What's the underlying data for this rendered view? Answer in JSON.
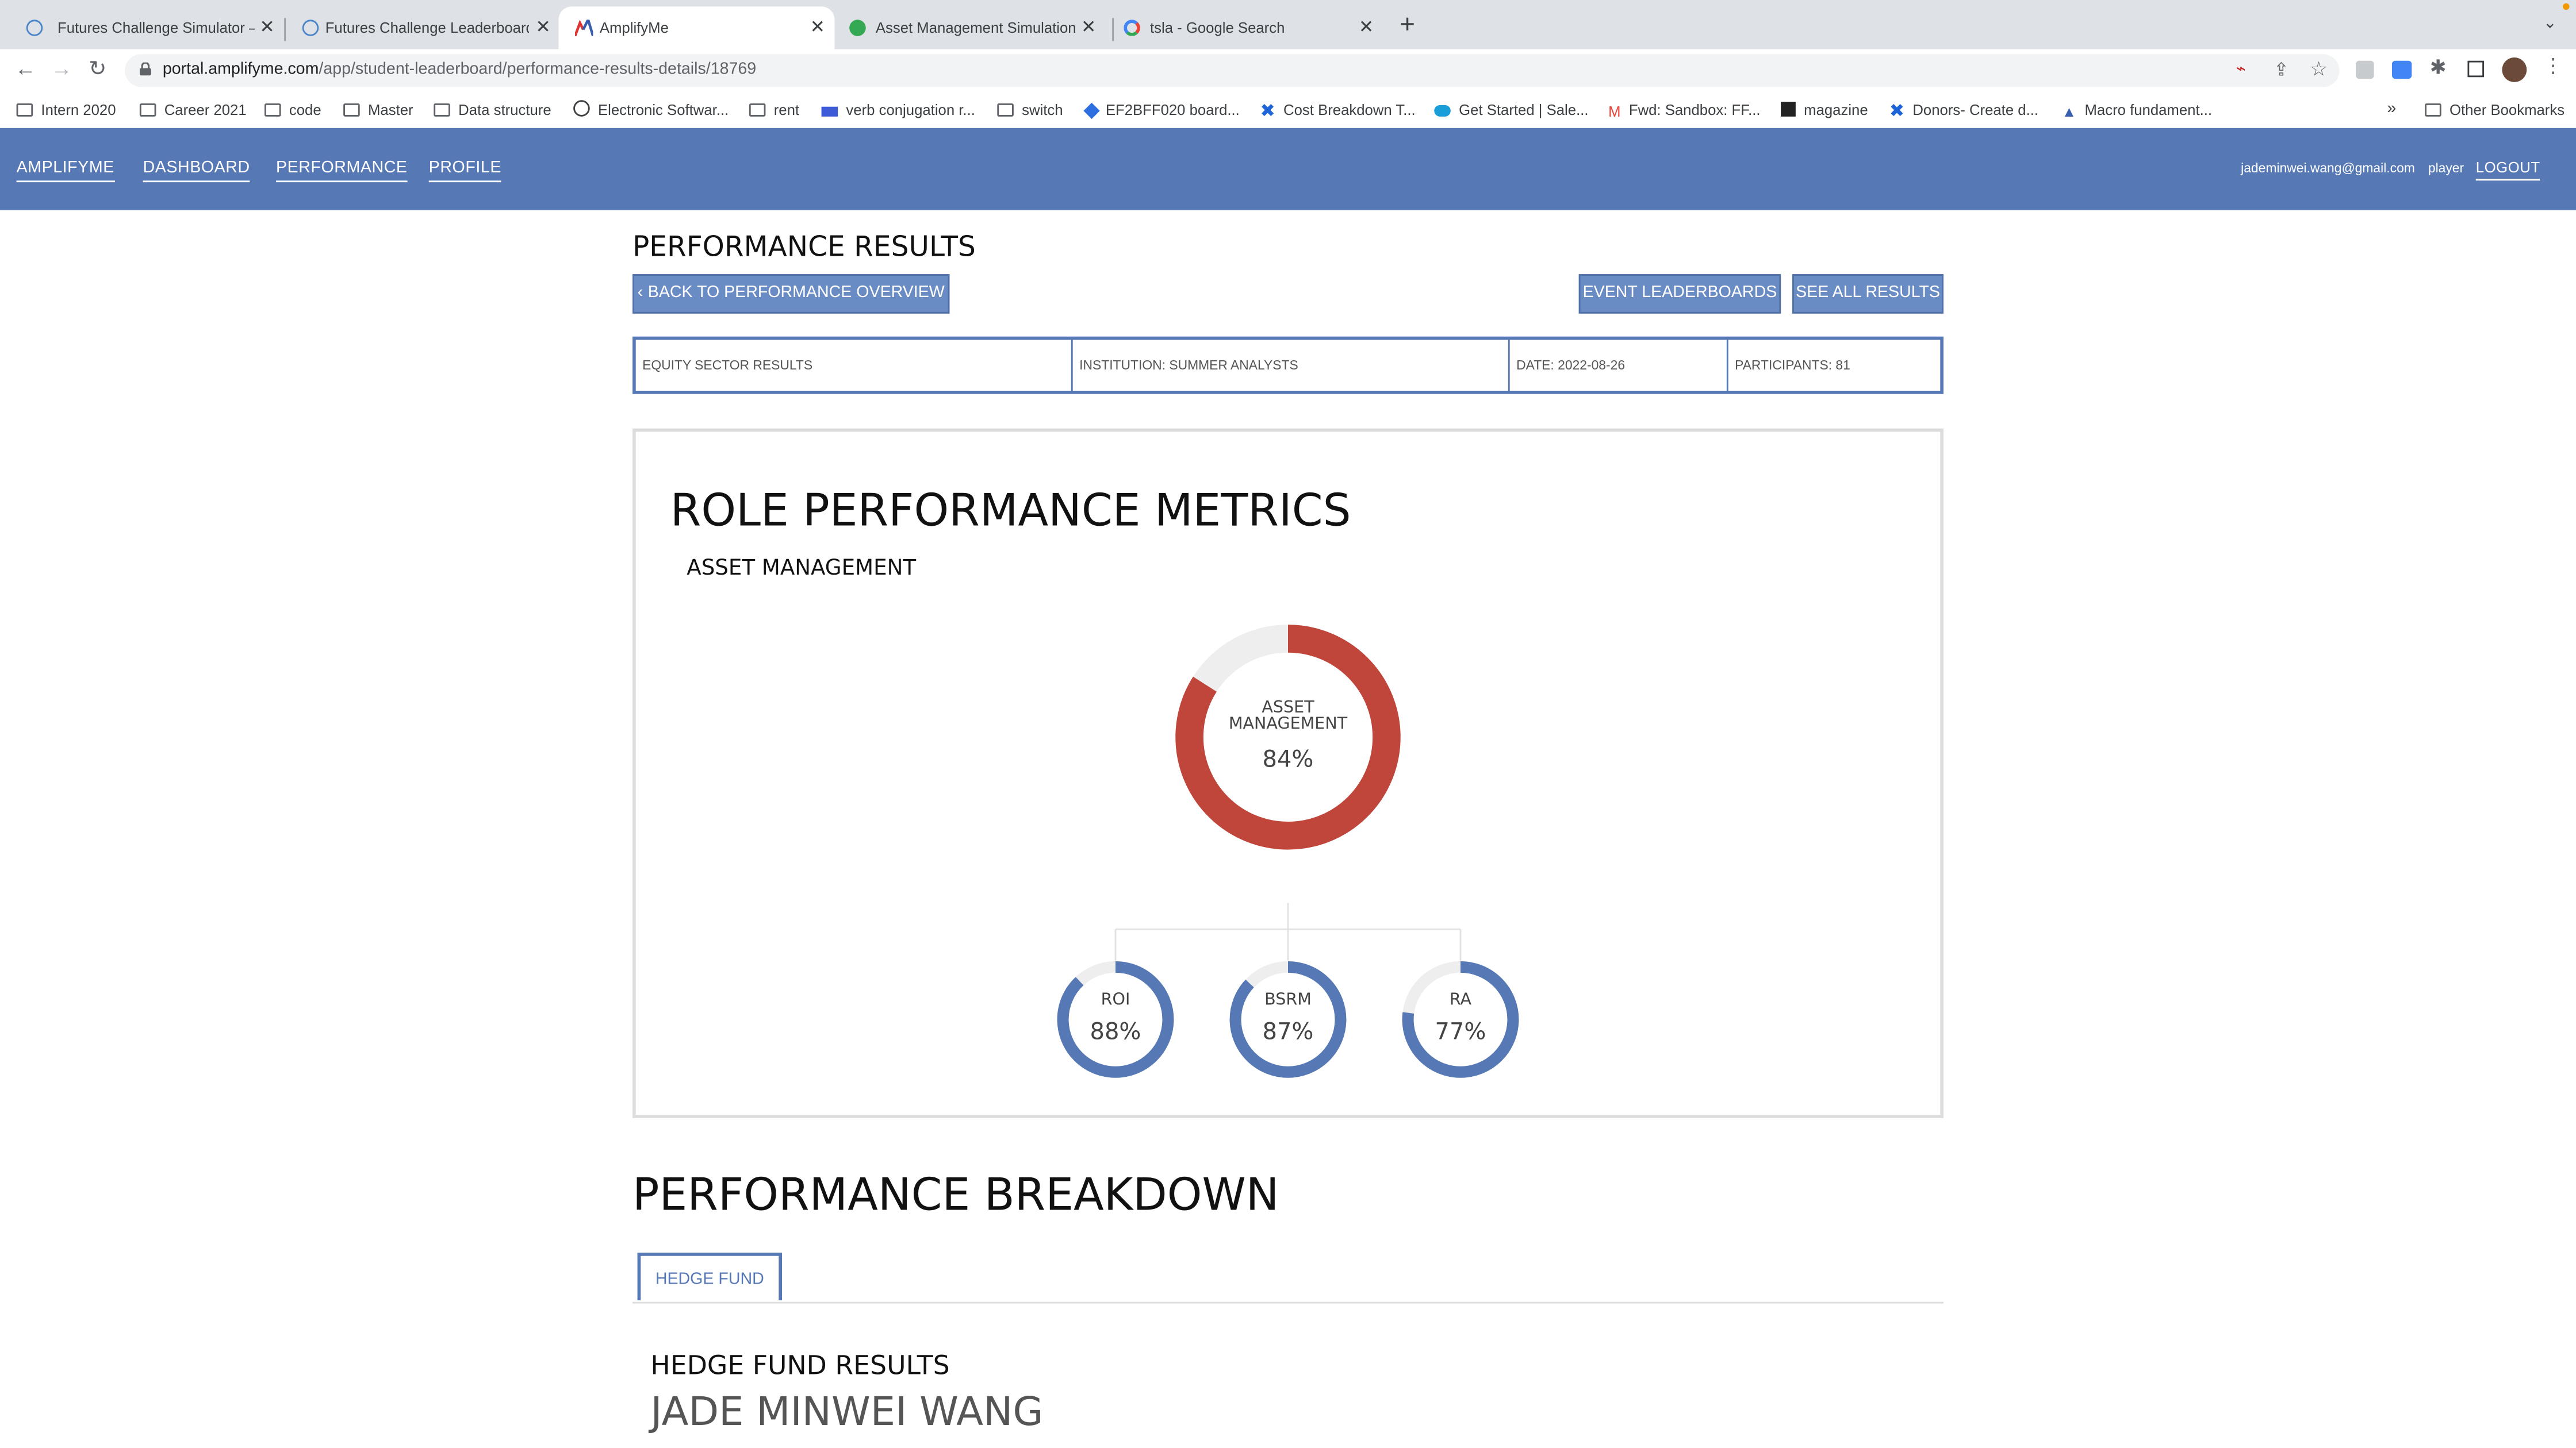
{
  "browser": {
    "tabs": [
      {
        "title": "Futures Challenge Simulator – ",
        "active": false
      },
      {
        "title": "Futures Challenge Leaderboard",
        "active": false
      },
      {
        "title": "AmplifyMe",
        "active": true
      },
      {
        "title": "Asset Management Simulation",
        "active": false
      },
      {
        "title": "tsla - Google Search",
        "active": false
      }
    ],
    "url_host": "portal.amplifyme.com",
    "url_path": "/app/student-leaderboard/performance-results-details/18769",
    "bookmarks": [
      "Intern 2020",
      "Career 2021",
      "code",
      "Master",
      "Data structure",
      "Electronic Softwar...",
      "rent",
      "verb conjugation r...",
      "switch",
      "EF2BFF020 board...",
      "Cost Breakdown T...",
      "Get Started | Sale...",
      "Fwd: Sandbox: FF...",
      "magazine",
      "Donors- Create d...",
      "Macro fundament..."
    ],
    "bookmarks_overflow": "»",
    "other_bookmarks": "Other Bookmarks"
  },
  "nav": {
    "brand": "AMPLIFYME",
    "dashboard": "DASHBOARD",
    "performance": "PERFORMANCE",
    "profile": "PROFILE",
    "email": "jademinwei.wang@gmail.com",
    "role": "player",
    "logout": "LOGOUT"
  },
  "page": {
    "title": "PERFORMANCE RESULTS",
    "back_button": "BACK TO PERFORMANCE OVERVIEW",
    "event_leaderboards": "EVENT LEADERBOARDS",
    "see_all_results": "SEE ALL RESULTS",
    "info": {
      "sector": "EQUITY SECTOR RESULTS",
      "institution": "INSTITUTION: SUMMER ANALYSTS",
      "date": "DATE: 2022-08-26",
      "participants": "PARTICIPANTS: 81"
    }
  },
  "metrics": {
    "title": "ROLE PERFORMANCE METRICS",
    "subtitle": "ASSET MANAGEMENT",
    "main": {
      "label_line1": "ASSET",
      "label_line2": "MANAGEMENT",
      "value": 84,
      "display": "84%"
    },
    "children": [
      {
        "label": "ROI",
        "value": 88,
        "display": "88%"
      },
      {
        "label": "BSRM",
        "value": 87,
        "display": "87%"
      },
      {
        "label": "RA",
        "value": 77,
        "display": "77%"
      }
    ],
    "colors": {
      "main": "#c0453a",
      "child": "#5679b6",
      "track": "#eeeeee"
    }
  },
  "breakdown": {
    "title": "PERFORMANCE BREAKDOWN",
    "tab": "HEDGE FUND",
    "results_title": "HEDGE FUND RESULTS",
    "player_name": "JADE MINWEI WANG"
  },
  "colors": {
    "nav": "#5679b6",
    "button": "#6a8cc4",
    "accent_red": "#c0453a"
  }
}
